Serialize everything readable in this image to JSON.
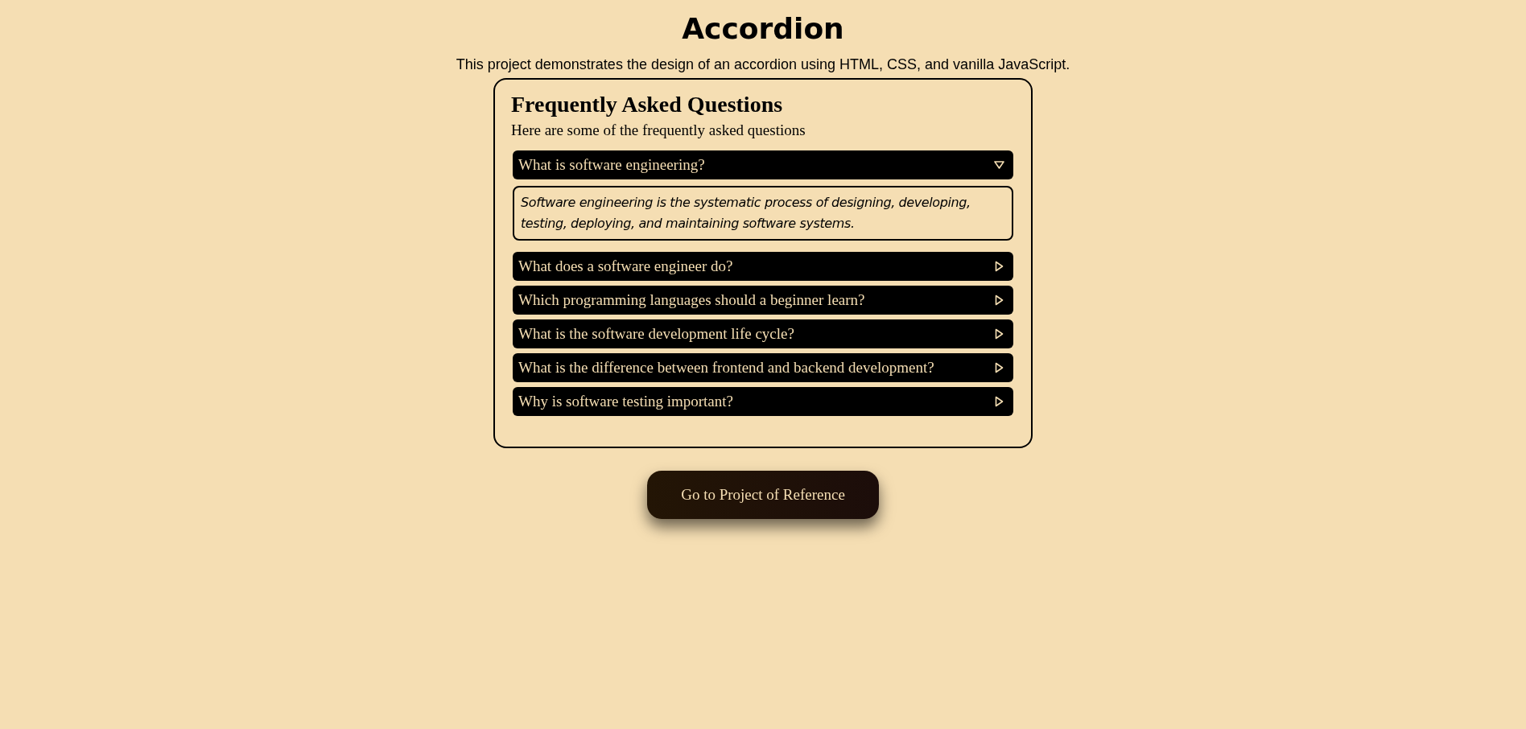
{
  "page": {
    "title": "Accordion",
    "description": "This project demonstrates the design of an accordion using HTML, CSS, and vanilla JavaScript."
  },
  "faq": {
    "heading": "Frequently Asked Questions",
    "intro": "Here are some of the frequently asked questions",
    "items": [
      {
        "question": "What is software engineering?",
        "expanded": true,
        "answer": "Software engineering is the systematic process of designing, developing, testing, deploying, and maintaining software systems."
      },
      {
        "question": "What does a software engineer do?",
        "expanded": false
      },
      {
        "question": "Which programming languages should a beginner learn?",
        "expanded": false
      },
      {
        "question": "What is the software development life cycle?",
        "expanded": false
      },
      {
        "question": "What is the difference between frontend and backend development?",
        "expanded": false
      },
      {
        "question": "Why is software testing important?",
        "expanded": false
      }
    ]
  },
  "button": {
    "label": "Go to Project of Reference"
  }
}
